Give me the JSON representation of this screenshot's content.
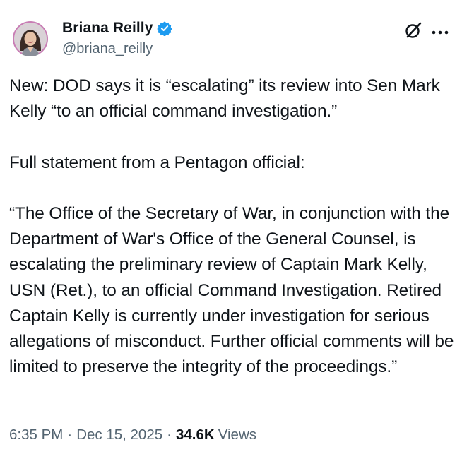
{
  "author": {
    "display_name": "Briana Reilly",
    "handle": "@briana_reilly",
    "verified": true,
    "verified_color": "#1d9bf0",
    "avatar_icon": "profile-photo"
  },
  "actions": {
    "grok_icon": "grok-icon",
    "more_icon": "more-horizontal-icon"
  },
  "tweet": {
    "paragraphs": [
      "New: DOD says it is “escalating” its review into Sen Mark Kelly “to an official command investigation.”",
      "Full statement from a Pentagon official:",
      "“The Office of the Secretary of War, in conjunction with the Department of War's Office of the General Counsel, is escalating the preliminary review of Captain Mark Kelly, USN (Ret.), to an official Command Investigation. Retired Captain Kelly is currently under investigation for serious allegations of misconduct. Further official comments will be limited to preserve the integrity of the proceedings.”"
    ]
  },
  "meta": {
    "time": "6:35 PM",
    "separator": "·",
    "date": "Dec 15, 2025",
    "views_count": "34.6K",
    "views_label": "Views"
  },
  "colors": {
    "text_primary": "#0f1419",
    "text_secondary": "#536471",
    "background": "#ffffff"
  }
}
